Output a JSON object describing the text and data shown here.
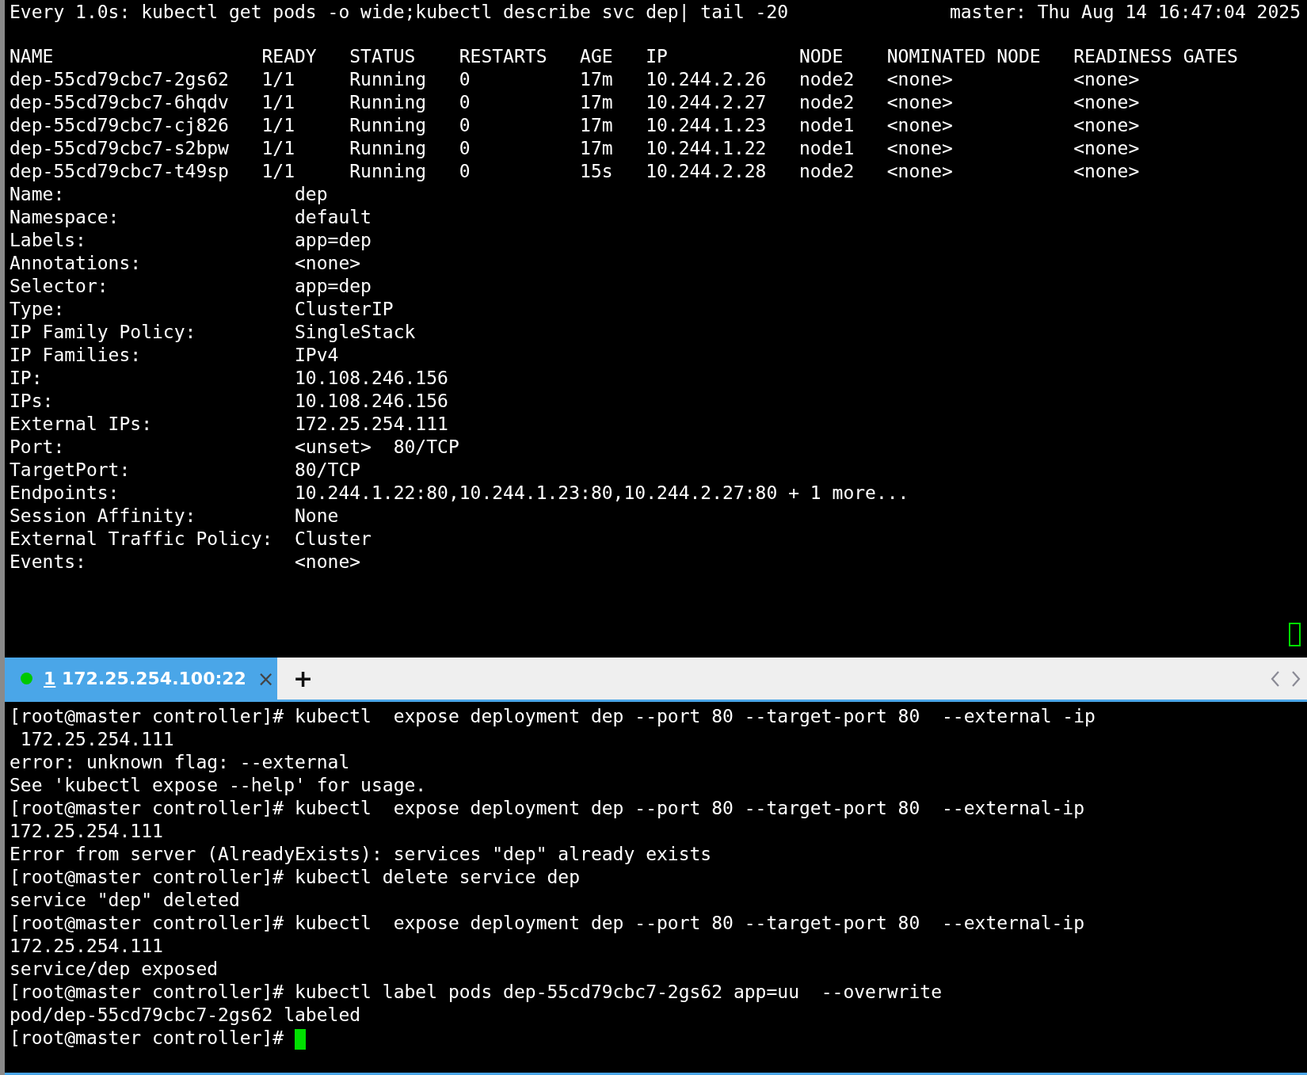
{
  "watch_pane": {
    "command": "Every 1.0s: kubectl get pods -o wide;kubectl describe svc dep| tail -20",
    "host_time": "master: Thu Aug 14 16:47:04 2025",
    "lines": [
      "NAME                   READY   STATUS    RESTARTS   AGE   IP            NODE    NOMINATED NODE   READINESS GATES",
      "dep-55cd79cbc7-2gs62   1/1     Running   0          17m   10.244.2.26   node2   <none>           <none>",
      "dep-55cd79cbc7-6hqdv   1/1     Running   0          17m   10.244.2.27   node2   <none>           <none>",
      "dep-55cd79cbc7-cj826   1/1     Running   0          17m   10.244.1.23   node1   <none>           <none>",
      "dep-55cd79cbc7-s2bpw   1/1     Running   0          17m   10.244.1.22   node1   <none>           <none>",
      "dep-55cd79cbc7-t49sp   1/1     Running   0          15s   10.244.2.28   node2   <none>           <none>",
      "Name:                     dep",
      "Namespace:                default",
      "Labels:                   app=dep",
      "Annotations:              <none>",
      "Selector:                 app=dep",
      "Type:                     ClusterIP",
      "IP Family Policy:         SingleStack",
      "IP Families:              IPv4",
      "IP:                       10.108.246.156",
      "IPs:                      10.108.246.156",
      "External IPs:             172.25.254.111",
      "Port:                     <unset>  80/TCP",
      "TargetPort:               80/TCP",
      "Endpoints:                10.244.1.22:80,10.244.1.23:80,10.244.2.27:80 + 1 more...",
      "Session Affinity:         None",
      "External Traffic Policy:  Cluster",
      "Events:                   <none>"
    ]
  },
  "tabs": [
    {
      "number": "1",
      "title": "172.25.254.100:22",
      "selected": true,
      "connected": true,
      "close": "×"
    }
  ],
  "new_tab": "+",
  "shell_pane": {
    "lines": [
      "[root@master controller]# kubectl  expose deployment dep --port 80 --target-port 80  --external -ip",
      " 172.25.254.111",
      "error: unknown flag: --external",
      "See 'kubectl expose --help' for usage.",
      "[root@master controller]# kubectl  expose deployment dep --port 80 --target-port 80  --external-ip",
      "172.25.254.111",
      "Error from server (AlreadyExists): services \"dep\" already exists",
      "[root@master controller]# kubectl delete service dep",
      "service \"dep\" deleted",
      "[root@master controller]# kubectl  expose deployment dep --port 80 --target-port 80  --external-ip",
      "172.25.254.111",
      "service/dep exposed",
      "[root@master controller]# kubectl label pods dep-55cd79cbc7-2gs62 app=uu  --overwrite",
      "pod/dep-55cd79cbc7-2gs62 labeled"
    ],
    "prompt": "[root@master controller]# "
  }
}
